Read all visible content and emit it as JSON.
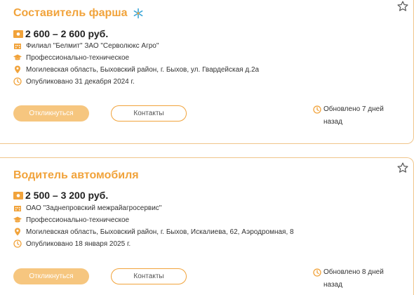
{
  "listings": [
    {
      "title": "Составитель фарша",
      "salary": "2 600 – 2 600 руб.",
      "company": "Филиал \"Белмит\" ЗАО \"Серволюкс Агро\"",
      "education": "Профессионально-техническое",
      "address": "Могилевская область, Быховский район, г. Быхов, ул. Гвардейская д.2а",
      "published": "Опубликовано 31 декабря 2024 г.",
      "apply_label": "Откликнуться",
      "contacts_label": "Контакты",
      "updated": "Обновлено 7 дней назад"
    },
    {
      "title": "Водитель автомобиля",
      "salary": "2 500 – 3 200 руб.",
      "company": "ОАО \"Заднепровский межрайагросервис\"",
      "education": "Профессионально-техническое",
      "address": "Могилевская область, Быховский район, г. Быхов, Искалиева, 62, Аэродромная, 8",
      "published": "Опубликовано 18 января 2025 г.",
      "apply_label": "Откликнуться",
      "contacts_label": "Контакты",
      "updated": "Обновлено 8 дней назад"
    }
  ],
  "colors": {
    "accent": "#f1a33b",
    "apply_bg": "#f6c67f",
    "border": "#f0c58a"
  }
}
